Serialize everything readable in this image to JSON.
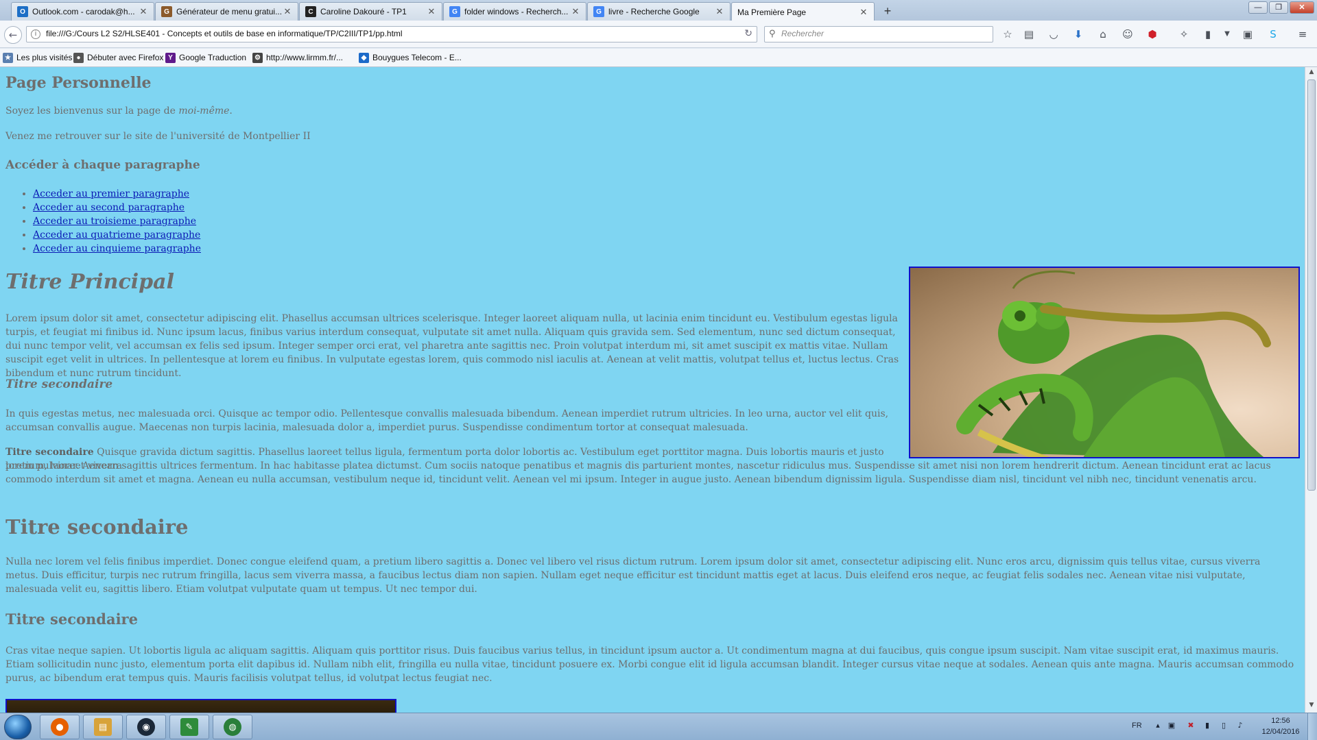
{
  "browser": {
    "tabs": [
      {
        "title": "Outlook.com - carodak@h...",
        "icon": "outlook-icon",
        "color": "#1d6fc6",
        "glyph": "O"
      },
      {
        "title": "Générateur de menu gratui...",
        "icon": "menu-generator-icon",
        "color": "#8b5a2b",
        "glyph": "G"
      },
      {
        "title": "Caroline Dakouré - TP1",
        "icon": "github-icon",
        "color": "#222222",
        "glyph": "C"
      },
      {
        "title": "folder windows - Recherch...",
        "icon": "google-icon",
        "color": "#4285f4",
        "glyph": "G"
      },
      {
        "title": "livre - Recherche Google",
        "icon": "google-icon",
        "color": "#4285f4",
        "glyph": "G"
      },
      {
        "title": "Ma Première Page",
        "icon": "",
        "color": "",
        "glyph": ""
      }
    ],
    "new_tab_symbol": "+",
    "window_controls": {
      "minimize": "—",
      "maximize": "❐",
      "close": "✕"
    },
    "url": "file:///G:/Cours L2 S2/HLSE401 - Concepts et outils de base en informatique/TP/C2III/TP1/pp.html",
    "search_placeholder": "Rechercher",
    "bookmarks": [
      {
        "label": "Les plus visités",
        "icon": "most-visited-icon",
        "color": "#5a7fb0",
        "glyph": "★"
      },
      {
        "label": "Débuter avec Firefox",
        "icon": "firefox-icon",
        "color": "#555555",
        "glyph": "●"
      },
      {
        "label": "Google Traduction",
        "icon": "yahoo-icon",
        "color": "#5f1a8b",
        "glyph": "Y"
      },
      {
        "label": "http://www.lirmm.fr/...",
        "icon": "lirmm-icon",
        "color": "#444444",
        "glyph": "⚙"
      },
      {
        "label": "Bouygues Telecom - E...",
        "icon": "bouygues-icon",
        "color": "#1c6ac9",
        "glyph": "◆"
      }
    ]
  },
  "page": {
    "title": "Page Personnelle",
    "welcome_prefix": "Soyez les bienvenus sur la page de ",
    "welcome_em": "moi-même",
    "welcome_suffix": ".",
    "university_text": "Venez me retrouver sur le site de l'université de Montpellier II",
    "nav_heading": "Accéder à chaque paragraphe",
    "nav_links": [
      "Acceder au premier paragraphe",
      "Acceder au second paragraphe",
      "Acceder au troisieme paragraphe",
      "Acceder au quatrieme paragraphe",
      "Acceder au cinquieme paragraphe"
    ],
    "main_title": "Titre Principal",
    "para1": "Lorem ipsum dolor sit amet, consectetur adipiscing elit. Phasellus accumsan ultrices scelerisque. Integer laoreet aliquam nulla, ut lacinia enim tincidunt eu. Vestibulum egestas ligula turpis, et feugiat mi finibus id. Nunc ipsum lacus, finibus varius interdum consequat, vulputate sit amet nulla. Aliquam quis gravida sem. Sed elementum, nunc sed dictum consequat, dui nunc tempor velit, vel accumsan ex felis sed ipsum. Integer semper orci erat, vel pharetra ante sagittis nec. Proin volutpat interdum mi, sit amet suscipit ex mattis vitae. Nullam suscipit eget velit in ultrices. In pellentesque at lorem eu finibus. In vulputate egestas lorem, quis commodo nisl iaculis at. Aenean at velit mattis, volutpat tellus et, luctus lectus. Cras bibendum et nunc rutrum tincidunt.",
    "subheading1": "Titre secondaire",
    "para2": "In quis egestas metus, nec malesuada orci. Quisque ac tempor odio. Pellentesque convallis malesuada bibendum. Aenean imperdiet rutrum ultricies. In leo urna, auctor vel elit quis, accumsan convallis augue. Maecenas non turpis lacinia, malesuada dolor a, imperdiet purus. Suspendisse condimentum tortor at consequat malesuada.",
    "para3_bold": "Titre secondaire",
    "para3_line1": " Quisque gravida dictum sagittis. Phasellus laoreet tellus ligula, fermentum porta dolor lobortis ac. Vestibulum eget porttitor magna. Duis lobortis mauris et justo pretium, laoreet viverra",
    "para3_rest": "lorem pulvinar. Aenean sagittis ultrices fermentum. In hac habitasse platea dictumst. Cum sociis natoque penatibus et magnis dis parturient montes, nascetur ridiculus mus. Suspendisse sit amet nisi non lorem hendrerit dictum. Aenean tincidunt erat ac lacus commodo interdum sit amet et magna. Aenean eu nulla accumsan, vestibulum neque id, tincidunt velit. Aenean vel mi ipsum. Integer in augue justo. Aenean bibendum dignissim ligula. Suspendisse diam nisl, tincidunt vel nibh nec, tincidunt venenatis arcu.",
    "section_title": "Titre secondaire",
    "para4": "Nulla nec lorem vel felis finibus imperdiet. Donec congue eleifend quam, a pretium libero sagittis a. Donec vel libero vel risus dictum rutrum. Lorem ipsum dolor sit amet, consectetur adipiscing elit. Nunc eros arcu, dignissim quis tellus vitae, cursus viverra metus. Duis efficitur, turpis nec rutrum fringilla, lacus sem viverra massa, a faucibus lectus diam non sapien. Nullam eget neque efficitur est tincidunt mattis eget at lacus. Duis eleifend eros neque, ac feugiat felis sodales nec. Aenean vitae nisi vulputate, malesuada velit eu, sagittis libero. Etiam volutpat vulputate quam ut tempus. Ut nec tempor dui.",
    "section_subtitle": "Titre secondaire",
    "para5": "Cras vitae neque sapien. Ut lobortis ligula ac aliquam sagittis. Aliquam quis porttitor risus. Duis faucibus varius tellus, in tincidunt ipsum auctor a. Ut condimentum magna at dui faucibus, quis congue ipsum suscipit. Nam vitae suscipit erat, id maximus mauris. Etiam sollicitudin nunc justo, elementum porta elit dapibus id. Nullam nibh elit, fringilla eu nulla vitae, tincidunt posuere ex. Morbi congue elit id ligula accumsan blandit. Integer cursus vitae neque at sodales. Aenean quis ante magna. Mauris accumsan commodo purus, ac bibendum erat tempus quis. Mauris facilisis volutpat tellus, id volutpat lectus feugiat nec."
  },
  "colors": {
    "page_background": "#7fd5f2",
    "text": "#6e6e6e",
    "link": "#0b1ab5",
    "image_border": "#1010c8"
  },
  "taskbar": {
    "apps": [
      {
        "name": "firefox-app",
        "glyph": "●",
        "color": "#e66000"
      },
      {
        "name": "explorer-app",
        "glyph": "▤",
        "color": "#d8a33a"
      },
      {
        "name": "steam-app",
        "glyph": "◉",
        "color": "#1b2838"
      },
      {
        "name": "notepad-app",
        "glyph": "✎",
        "color": "#2e8b3a"
      },
      {
        "name": "globe-app",
        "glyph": "◍",
        "color": "#2a7f3a"
      }
    ],
    "language": "FR",
    "time": "12:56",
    "date": "12/04/2016"
  }
}
